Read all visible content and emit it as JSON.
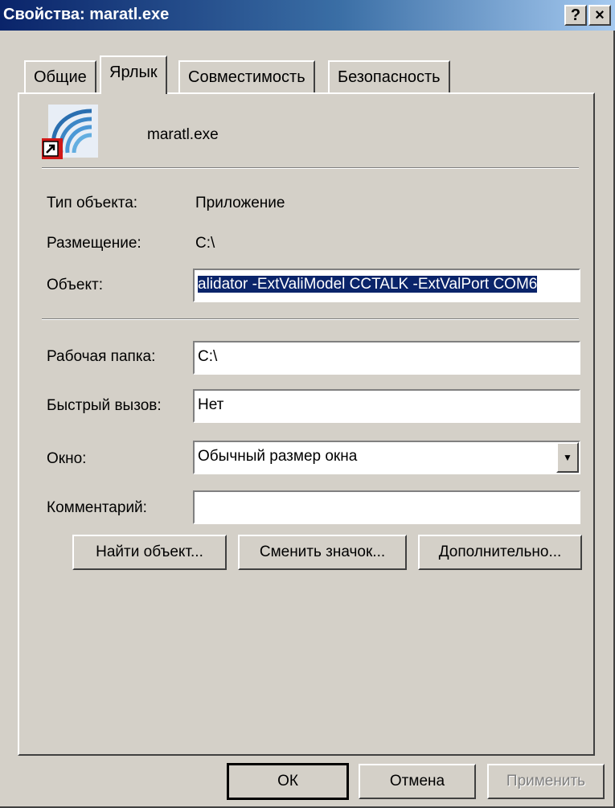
{
  "window": {
    "title": "Свойства: maratl.exe",
    "help_label": "?",
    "close_label": "×"
  },
  "tabs": [
    {
      "label": "Общие"
    },
    {
      "label": "Ярлык",
      "active": true
    },
    {
      "label": "Совместимость"
    },
    {
      "label": "Безопасность"
    }
  ],
  "shortcut": {
    "icon": "maratl-app-icon",
    "name": "maratl.exe"
  },
  "info": {
    "type_label": "Тип объекта:",
    "type_value": "Приложение",
    "location_label": "Размещение:",
    "location_value": "C:\\"
  },
  "target": {
    "label": "Объект:",
    "value": "alidator -ExtValiModel CCTALK -ExtValPort COM6"
  },
  "workdir": {
    "label": "Рабочая папка:",
    "value": "C:\\"
  },
  "hotkey": {
    "label": "Быстрый вызов:",
    "value": "Нет"
  },
  "window_mode": {
    "label": "Окно:",
    "value": "Обычный размер окна"
  },
  "comment": {
    "label": "Комментарий:",
    "value": ""
  },
  "actions": {
    "find_target": "Найти объект...",
    "change_icon": "Сменить значок...",
    "advanced": "Дополнительно..."
  },
  "footer": {
    "ok": "ОК",
    "cancel": "Отмена",
    "apply": "Применить"
  },
  "colors": {
    "title_bar": "#0a246a",
    "face": "#d4d0c8",
    "selection": "#0a246a"
  }
}
